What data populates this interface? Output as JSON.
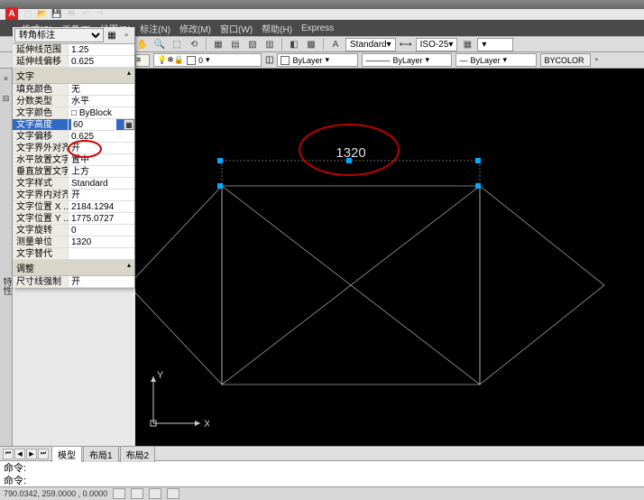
{
  "app": {
    "letter": "A"
  },
  "menu": {
    "items": [
      "格式(O)",
      "工具(T)",
      "绘图(D)",
      "标注(N)",
      "修改(M)",
      "窗口(W)",
      "帮助(H)",
      "Express"
    ]
  },
  "toolbar": {
    "style_label": "Standard",
    "dimstyle_label": "ISO-25"
  },
  "layer_bar": {
    "layer": "0",
    "color_layer": "ByLayer",
    "linetype": "ByLayer",
    "lineweight": "ByLayer",
    "plotstyle": "BYCOLOR"
  },
  "properties": {
    "title": "转角标注",
    "rows_top": [
      {
        "lbl": "延伸线范围",
        "val": "1.25"
      },
      {
        "lbl": "延伸线偏移",
        "val": "0.625"
      }
    ],
    "sec_text": "文字",
    "rows_text": [
      {
        "lbl": "填充颜色",
        "val": "无"
      },
      {
        "lbl": "分数类型",
        "val": "水平"
      },
      {
        "lbl": "文字颜色",
        "val": "□ ByBlock"
      }
    ],
    "sel_row": {
      "lbl": "文字高度",
      "val": "60"
    },
    "rows_text2": [
      {
        "lbl": "文字偏移",
        "val": "0.625"
      },
      {
        "lbl": "文字界外对齐",
        "val": "开"
      },
      {
        "lbl": "水平放置文字",
        "val": "置中"
      },
      {
        "lbl": "垂直放置文字",
        "val": "上方"
      },
      {
        "lbl": "文字样式",
        "val": "Standard"
      },
      {
        "lbl": "文字界内对齐",
        "val": "开"
      },
      {
        "lbl": "文字位置 X ...",
        "val": "2184.1294"
      },
      {
        "lbl": "文字位置 Y ...",
        "val": "1775.0727"
      },
      {
        "lbl": "文字旋转",
        "val": "0"
      },
      {
        "lbl": "测量单位",
        "val": "1320"
      },
      {
        "lbl": "文字替代",
        "val": ""
      }
    ],
    "sec_adj": "调整",
    "rows_adj": [
      {
        "lbl": "尺寸线强制",
        "val": "开"
      }
    ]
  },
  "side_label": "特性",
  "canvas": {
    "dim_text": "1320",
    "ucs_x": "X",
    "ucs_y": "Y"
  },
  "tabs": {
    "model": "模型",
    "layout1": "布局1",
    "layout2": "布局2"
  },
  "cmd": {
    "prompt1": "命令:",
    "prompt2": "命令:"
  },
  "status": {
    "coords": "790.0342,   259.0000 ,  0.0000"
  }
}
